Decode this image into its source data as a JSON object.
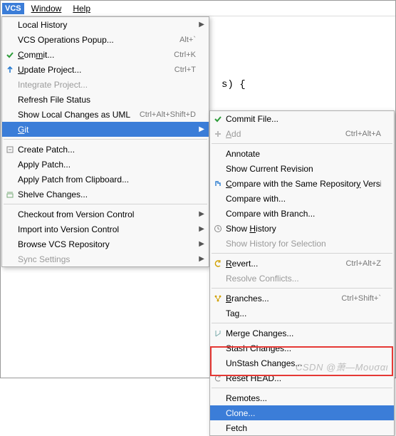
{
  "menubar": {
    "badge": "VCS",
    "window": "Window",
    "help": "Help"
  },
  "bg_code": "s) {",
  "left": {
    "local_history": "Local History",
    "vcs_ops": "VCS Operations Popup...",
    "vcs_ops_key": "Alt+`",
    "commit": "Commit...",
    "commit_key": "Ctrl+K",
    "update": "Update Project...",
    "update_key": "Ctrl+T",
    "integrate": "Integrate Project...",
    "refresh": "Refresh File Status",
    "show_uml": "Show Local Changes as UML",
    "show_uml_key": "Ctrl+Alt+Shift+D",
    "git": "Git",
    "create_patch": "Create Patch...",
    "apply_patch": "Apply Patch...",
    "apply_clip": "Apply Patch from Clipboard...",
    "shelve": "Shelve Changes...",
    "checkout": "Checkout from Version Control",
    "import": "Import into Version Control",
    "browse": "Browse VCS Repository",
    "sync": "Sync Settings"
  },
  "right": {
    "commit_file": "Commit File...",
    "add": "Add",
    "add_key": "Ctrl+Alt+A",
    "annotate": "Annotate",
    "show_rev": "Show Current Revision",
    "compare_repo": "Compare with the Same Repository Version",
    "compare_with": "Compare with...",
    "compare_branch": "Compare with Branch...",
    "show_history": "Show History",
    "show_hist_sel": "Show History for Selection",
    "revert": "Revert...",
    "revert_key": "Ctrl+Alt+Z",
    "resolve": "Resolve Conflicts...",
    "branches": "Branches...",
    "branches_key": "Ctrl+Shift+`",
    "tag": "Tag...",
    "merge": "Merge Changes...",
    "stash": "Stash Changes...",
    "unstash": "UnStash Changes...",
    "reset": "Reset HEAD...",
    "remotes": "Remotes...",
    "clone": "Clone...",
    "fetch": "Fetch"
  },
  "watermark": "CSDN @萧—Μουσαι"
}
